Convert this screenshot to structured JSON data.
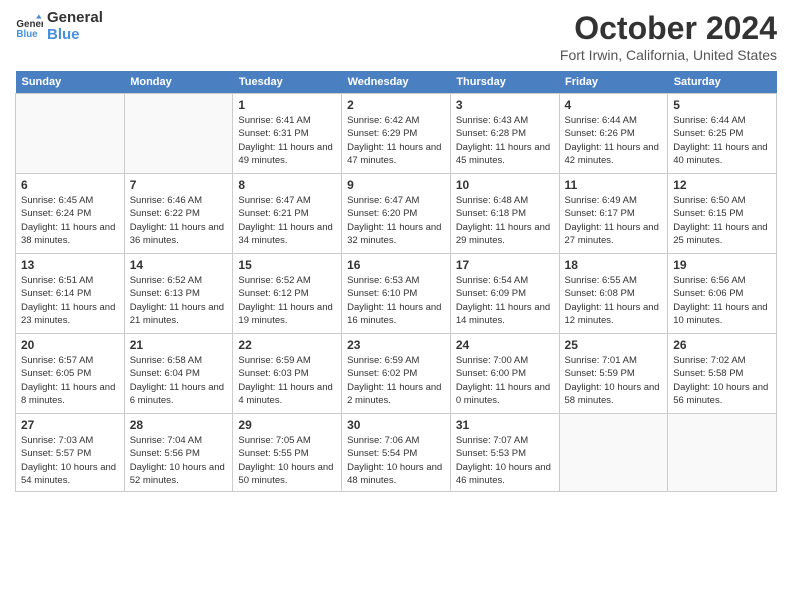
{
  "header": {
    "logo_line1": "General",
    "logo_line2": "Blue",
    "month": "October 2024",
    "location": "Fort Irwin, California, United States"
  },
  "days_of_week": [
    "Sunday",
    "Monday",
    "Tuesday",
    "Wednesday",
    "Thursday",
    "Friday",
    "Saturday"
  ],
  "weeks": [
    [
      {
        "day": "",
        "content": ""
      },
      {
        "day": "",
        "content": ""
      },
      {
        "day": "1",
        "content": "Sunrise: 6:41 AM\nSunset: 6:31 PM\nDaylight: 11 hours and 49 minutes."
      },
      {
        "day": "2",
        "content": "Sunrise: 6:42 AM\nSunset: 6:29 PM\nDaylight: 11 hours and 47 minutes."
      },
      {
        "day": "3",
        "content": "Sunrise: 6:43 AM\nSunset: 6:28 PM\nDaylight: 11 hours and 45 minutes."
      },
      {
        "day": "4",
        "content": "Sunrise: 6:44 AM\nSunset: 6:26 PM\nDaylight: 11 hours and 42 minutes."
      },
      {
        "day": "5",
        "content": "Sunrise: 6:44 AM\nSunset: 6:25 PM\nDaylight: 11 hours and 40 minutes."
      }
    ],
    [
      {
        "day": "6",
        "content": "Sunrise: 6:45 AM\nSunset: 6:24 PM\nDaylight: 11 hours and 38 minutes."
      },
      {
        "day": "7",
        "content": "Sunrise: 6:46 AM\nSunset: 6:22 PM\nDaylight: 11 hours and 36 minutes."
      },
      {
        "day": "8",
        "content": "Sunrise: 6:47 AM\nSunset: 6:21 PM\nDaylight: 11 hours and 34 minutes."
      },
      {
        "day": "9",
        "content": "Sunrise: 6:47 AM\nSunset: 6:20 PM\nDaylight: 11 hours and 32 minutes."
      },
      {
        "day": "10",
        "content": "Sunrise: 6:48 AM\nSunset: 6:18 PM\nDaylight: 11 hours and 29 minutes."
      },
      {
        "day": "11",
        "content": "Sunrise: 6:49 AM\nSunset: 6:17 PM\nDaylight: 11 hours and 27 minutes."
      },
      {
        "day": "12",
        "content": "Sunrise: 6:50 AM\nSunset: 6:15 PM\nDaylight: 11 hours and 25 minutes."
      }
    ],
    [
      {
        "day": "13",
        "content": "Sunrise: 6:51 AM\nSunset: 6:14 PM\nDaylight: 11 hours and 23 minutes."
      },
      {
        "day": "14",
        "content": "Sunrise: 6:52 AM\nSunset: 6:13 PM\nDaylight: 11 hours and 21 minutes."
      },
      {
        "day": "15",
        "content": "Sunrise: 6:52 AM\nSunset: 6:12 PM\nDaylight: 11 hours and 19 minutes."
      },
      {
        "day": "16",
        "content": "Sunrise: 6:53 AM\nSunset: 6:10 PM\nDaylight: 11 hours and 16 minutes."
      },
      {
        "day": "17",
        "content": "Sunrise: 6:54 AM\nSunset: 6:09 PM\nDaylight: 11 hours and 14 minutes."
      },
      {
        "day": "18",
        "content": "Sunrise: 6:55 AM\nSunset: 6:08 PM\nDaylight: 11 hours and 12 minutes."
      },
      {
        "day": "19",
        "content": "Sunrise: 6:56 AM\nSunset: 6:06 PM\nDaylight: 11 hours and 10 minutes."
      }
    ],
    [
      {
        "day": "20",
        "content": "Sunrise: 6:57 AM\nSunset: 6:05 PM\nDaylight: 11 hours and 8 minutes."
      },
      {
        "day": "21",
        "content": "Sunrise: 6:58 AM\nSunset: 6:04 PM\nDaylight: 11 hours and 6 minutes."
      },
      {
        "day": "22",
        "content": "Sunrise: 6:59 AM\nSunset: 6:03 PM\nDaylight: 11 hours and 4 minutes."
      },
      {
        "day": "23",
        "content": "Sunrise: 6:59 AM\nSunset: 6:02 PM\nDaylight: 11 hours and 2 minutes."
      },
      {
        "day": "24",
        "content": "Sunrise: 7:00 AM\nSunset: 6:00 PM\nDaylight: 11 hours and 0 minutes."
      },
      {
        "day": "25",
        "content": "Sunrise: 7:01 AM\nSunset: 5:59 PM\nDaylight: 10 hours and 58 minutes."
      },
      {
        "day": "26",
        "content": "Sunrise: 7:02 AM\nSunset: 5:58 PM\nDaylight: 10 hours and 56 minutes."
      }
    ],
    [
      {
        "day": "27",
        "content": "Sunrise: 7:03 AM\nSunset: 5:57 PM\nDaylight: 10 hours and 54 minutes."
      },
      {
        "day": "28",
        "content": "Sunrise: 7:04 AM\nSunset: 5:56 PM\nDaylight: 10 hours and 52 minutes."
      },
      {
        "day": "29",
        "content": "Sunrise: 7:05 AM\nSunset: 5:55 PM\nDaylight: 10 hours and 50 minutes."
      },
      {
        "day": "30",
        "content": "Sunrise: 7:06 AM\nSunset: 5:54 PM\nDaylight: 10 hours and 48 minutes."
      },
      {
        "day": "31",
        "content": "Sunrise: 7:07 AM\nSunset: 5:53 PM\nDaylight: 10 hours and 46 minutes."
      },
      {
        "day": "",
        "content": ""
      },
      {
        "day": "",
        "content": ""
      }
    ]
  ]
}
